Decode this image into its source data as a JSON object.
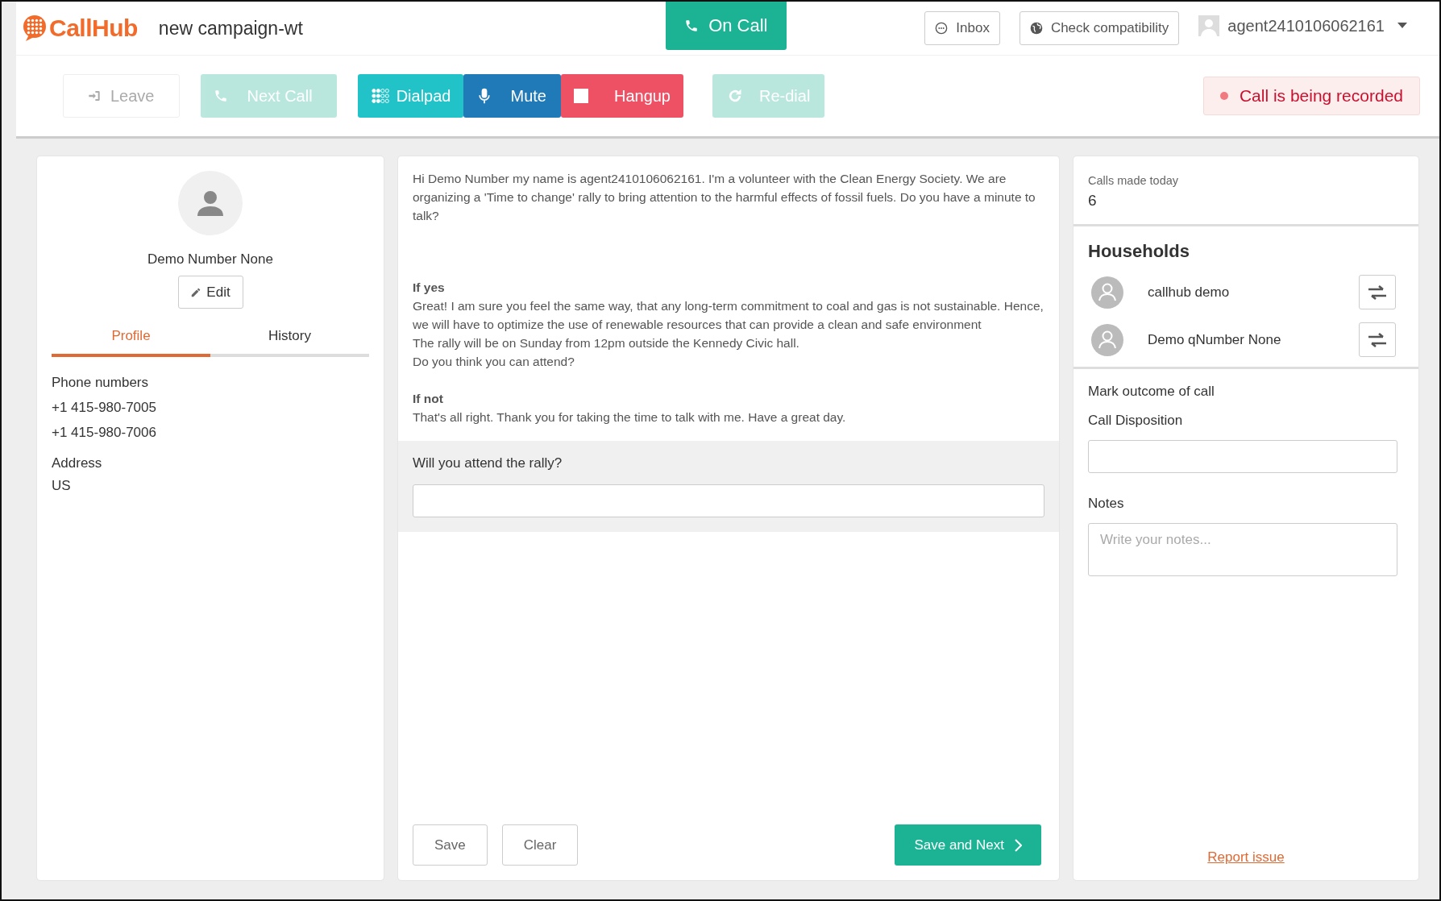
{
  "header": {
    "logo": "CallHub",
    "campaign": "new campaign-wt",
    "on_call": "On Call",
    "inbox": "Inbox",
    "check": "Check compatibility",
    "user": "agent2410106062161"
  },
  "actions": [
    {
      "kind": "leave",
      "label": "Leave",
      "disabled": true
    },
    {
      "kind": "next",
      "label": "Next Call",
      "disabled": true
    },
    {
      "kind": "dialpad",
      "label": "Dialpad",
      "disabled": false
    },
    {
      "kind": "mute",
      "label": "Mute",
      "disabled": false
    },
    {
      "kind": "hangup",
      "label": "Hangup",
      "disabled": false
    },
    {
      "kind": "redial",
      "label": "Re-dial",
      "disabled": true
    }
  ],
  "recording": "Call is being recorded",
  "contact": {
    "name": "Demo Number None",
    "edit": "Edit",
    "tabs": [
      {
        "label": "Profile",
        "selected": true
      },
      {
        "label": "History",
        "selected": false
      }
    ],
    "phones_label": "Phone numbers",
    "phones": [
      "+1 415-980-7005",
      "+1 415-980-7006"
    ],
    "address_label": "Address",
    "address": "US"
  },
  "script": [
    {
      "kind": "text",
      "text": "Hi Demo Number my name is agent2410106062161. I'm a volunteer with the Clean Energy Society. We are organizing a 'Time to change' rally to bring attention to the harmful effects of fossil fuels. Do you have a minute to talk?"
    },
    {
      "kind": "heading",
      "text": "If yes"
    },
    {
      "kind": "text",
      "text": "Great! I am sure you feel the same way, that any long-term commitment to coal and gas is not sustainable. Hence, we will have to optimize the use of renewable resources that can provide a clean and safe environment"
    },
    {
      "kind": "text",
      "text": "The rally will be on Sunday from 12pm outside the Kennedy Civic hall."
    },
    {
      "kind": "text",
      "text": "Do you think you can attend?"
    },
    {
      "kind": "heading",
      "text": "If not"
    },
    {
      "kind": "text",
      "text": "That's all right. Thank you for taking the time to talk with me. Have a great day."
    }
  ],
  "question": {
    "label": "Will you attend the rally?"
  },
  "footer": {
    "save": "Save",
    "clear": "Clear",
    "save_next": "Save and Next"
  },
  "stats": {
    "label": "Calls made today",
    "value": "6"
  },
  "households": {
    "title": "Households",
    "members": [
      {
        "name": "callhub demo"
      },
      {
        "name": "Demo qNumber None"
      }
    ]
  },
  "outcome": {
    "title": "Mark outcome of call",
    "disposition_label": "Call Disposition",
    "notes_label": "Notes",
    "notes_placeholder": "Write your notes...",
    "report": "Report issue"
  }
}
